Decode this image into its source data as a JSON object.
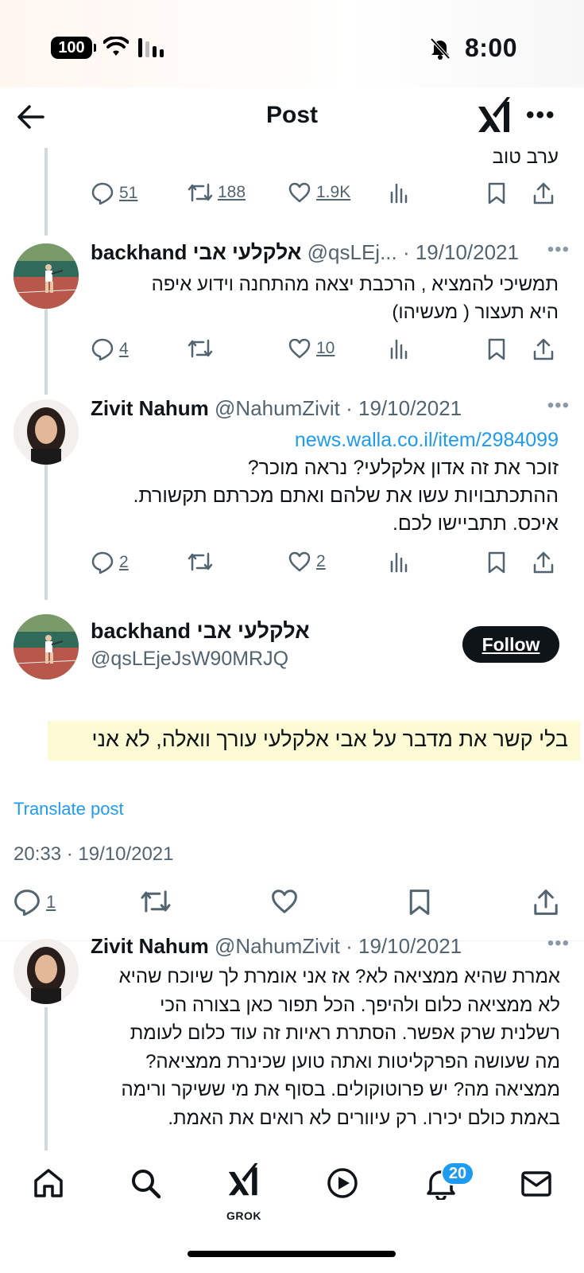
{
  "status_bar": {
    "battery": "100",
    "time": "8:00"
  },
  "header": {
    "title": "Post"
  },
  "reply_above": {
    "text_tail": "ערב טוב",
    "stats": {
      "replies": "51",
      "reposts": "188",
      "likes": "1.9K"
    }
  },
  "reply1": {
    "name": "backhand אלקלעי אבי",
    "handle_date": "@qsLEj... · 19/10/2021",
    "lines": [
      "תמשיכי להמציא , הרכבת יצאה מהתחנה וידוע איפה",
      "היא תעצור ( מעשיהו)"
    ],
    "stats": {
      "replies": "4",
      "likes": "10"
    }
  },
  "reply2": {
    "name": "Zivit Nahum",
    "handle_date": "@NahumZivit · 19/10/2021",
    "link": "news.walla.co.il/item/2984099",
    "lines": [
      "זוכר את זה אדון אלקלעי? נראה מוכר?",
      "ההתכתבויות עשו את שלהם ואתם מכרתם תקשורת.",
      "איכס. תתביישו לכם."
    ],
    "stats": {
      "replies": "2",
      "likes": "2"
    }
  },
  "main_post": {
    "name": "backhand אלקלעי אבי",
    "handle": "@qsLEjeJsW90MRJQ",
    "follow_label": "Follow",
    "text": "בלי קשר את מדבר על אבי אלקלעי עורך וואלה, לא אני",
    "translate_label": "Translate post",
    "timestamp": "20:33 · 19/10/2021",
    "stats": {
      "replies": "1"
    }
  },
  "reply3": {
    "name": "Zivit Nahum",
    "handle_date": "@NahumZivit · 19/10/2021",
    "lines": [
      "אמרת שהיא ממציאה לא? אז אני אומרת לך שיוכח שהיא",
      "לא ממציאה כלום ולהיפך. הכל תפור כאן בצורה הכי",
      "רשלנית שרק אפשר. הסתרת ראיות זה עוד כלום לעומת",
      "מה שעושה הפרקליטות ואתה טוען שכינרת ממציאה?",
      "ממציאה מה? יש פרוטוקולים. בסוף את מי ששיקר ורימה",
      "באמת כולם יכירו. רק עיוורים לא רואים את האמת."
    ]
  },
  "bottom_nav": {
    "grok_label": "GROK",
    "notifications_badge": "20"
  },
  "colors": {
    "accent": "#1d9bf0",
    "text": "#0f1419",
    "muted": "#536471",
    "highlight": "#fdfbd4"
  }
}
